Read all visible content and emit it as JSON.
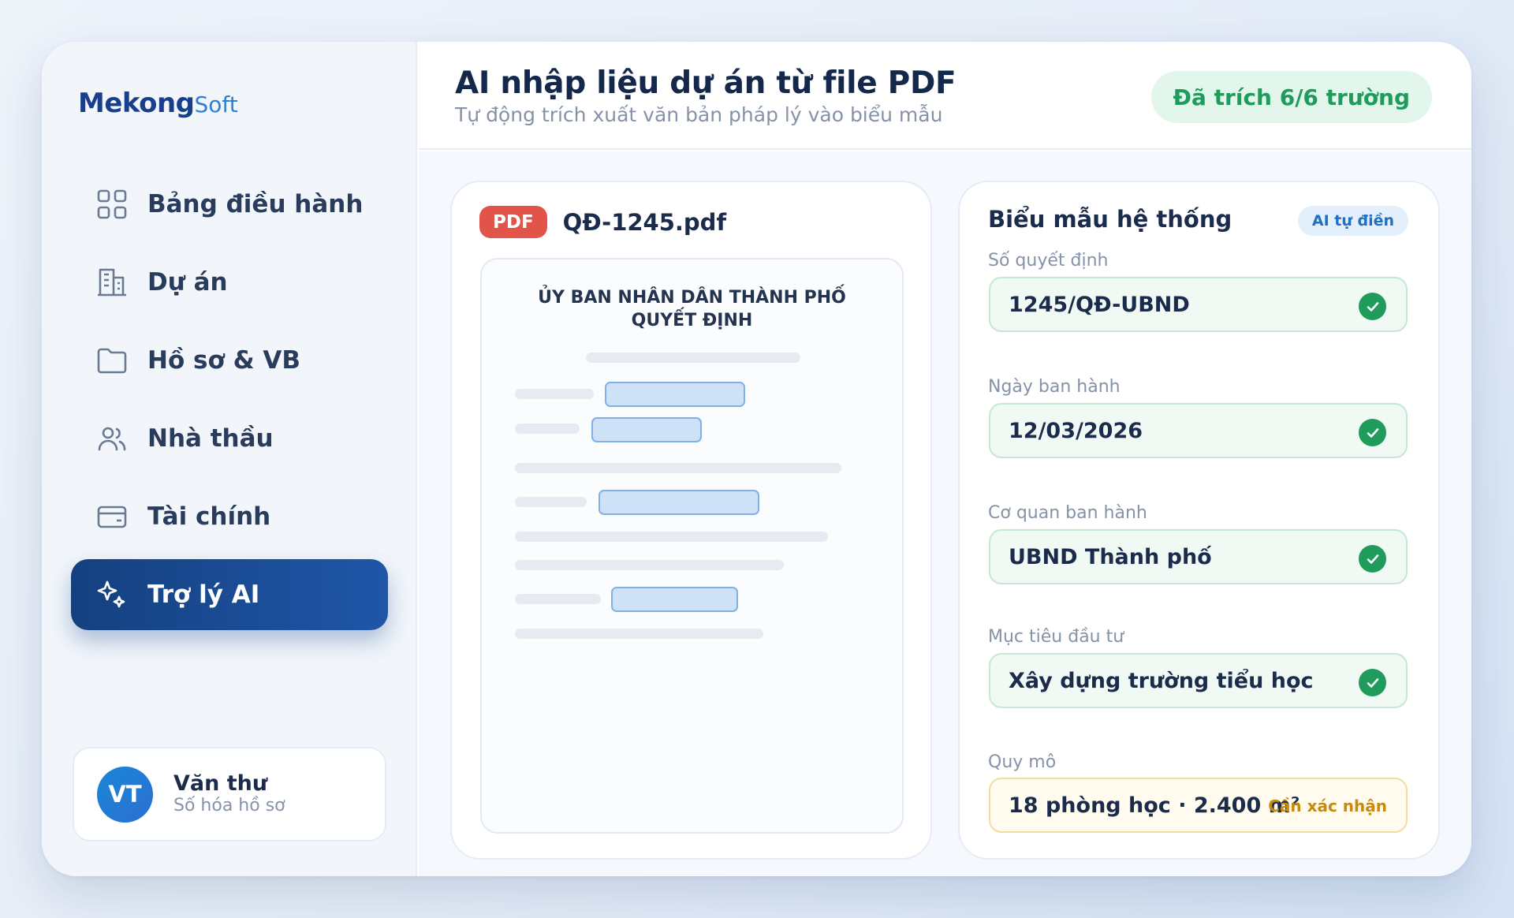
{
  "brand": {
    "name_main": "Mekong",
    "name_sub": "Soft",
    "accent": "#173f8c",
    "accent_light": "#2f7fd6"
  },
  "sidebar": {
    "items": [
      {
        "label": "Bảng điều hành",
        "icon": "grid-icon",
        "active": false
      },
      {
        "label": "Dự án",
        "icon": "building-icon",
        "active": false
      },
      {
        "label": "Hồ sơ & VB",
        "icon": "folder-icon",
        "active": false
      },
      {
        "label": "Nhà thầu",
        "icon": "users-icon",
        "active": false
      },
      {
        "label": "Tài chính",
        "icon": "wallet-icon",
        "active": false
      },
      {
        "label": "Trợ lý AI",
        "icon": "sparkle-icon",
        "active": true
      }
    ],
    "active_color": "#1a4a94"
  },
  "user": {
    "initials": "VT",
    "name": "Văn thư",
    "role": "Số hóa hồ sơ"
  },
  "header": {
    "title": "AI nhập liệu dự án từ file PDF",
    "subtitle": "Tự động trích xuất văn bản pháp lý vào biểu mẫu",
    "status": "Đã trích 6/6 trường",
    "status_color": "#1f9b5c"
  },
  "pdf": {
    "badge": "PDF",
    "filename": "QĐ-1245.pdf",
    "doc_title_1": "ỦY BAN NHÂN DÂN THÀNH PHỐ",
    "doc_title_2": "QUYẾT ĐỊNH"
  },
  "form": {
    "title": "Biểu mẫu hệ thống",
    "ai_badge": "AI tự điền",
    "fields": [
      {
        "label": "Số quyết định",
        "value": "1245/QĐ-UBND",
        "status": "verified"
      },
      {
        "label": "Ngày ban hành",
        "value": "12/03/2026",
        "status": "verified"
      },
      {
        "label": "Cơ quan ban hành",
        "value": "UBND Thành phố",
        "status": "verified"
      },
      {
        "label": "Mục tiêu đầu tư",
        "value": "Xây dựng trường tiểu học",
        "status": "verified"
      },
      {
        "label": "Quy mô",
        "value": "18 phòng học · 2.400 m²",
        "status": "pending",
        "pending_label": "Cần xác nhận"
      }
    ],
    "verified_color": "#1f9b5c",
    "pending_color": "#c88a10"
  }
}
